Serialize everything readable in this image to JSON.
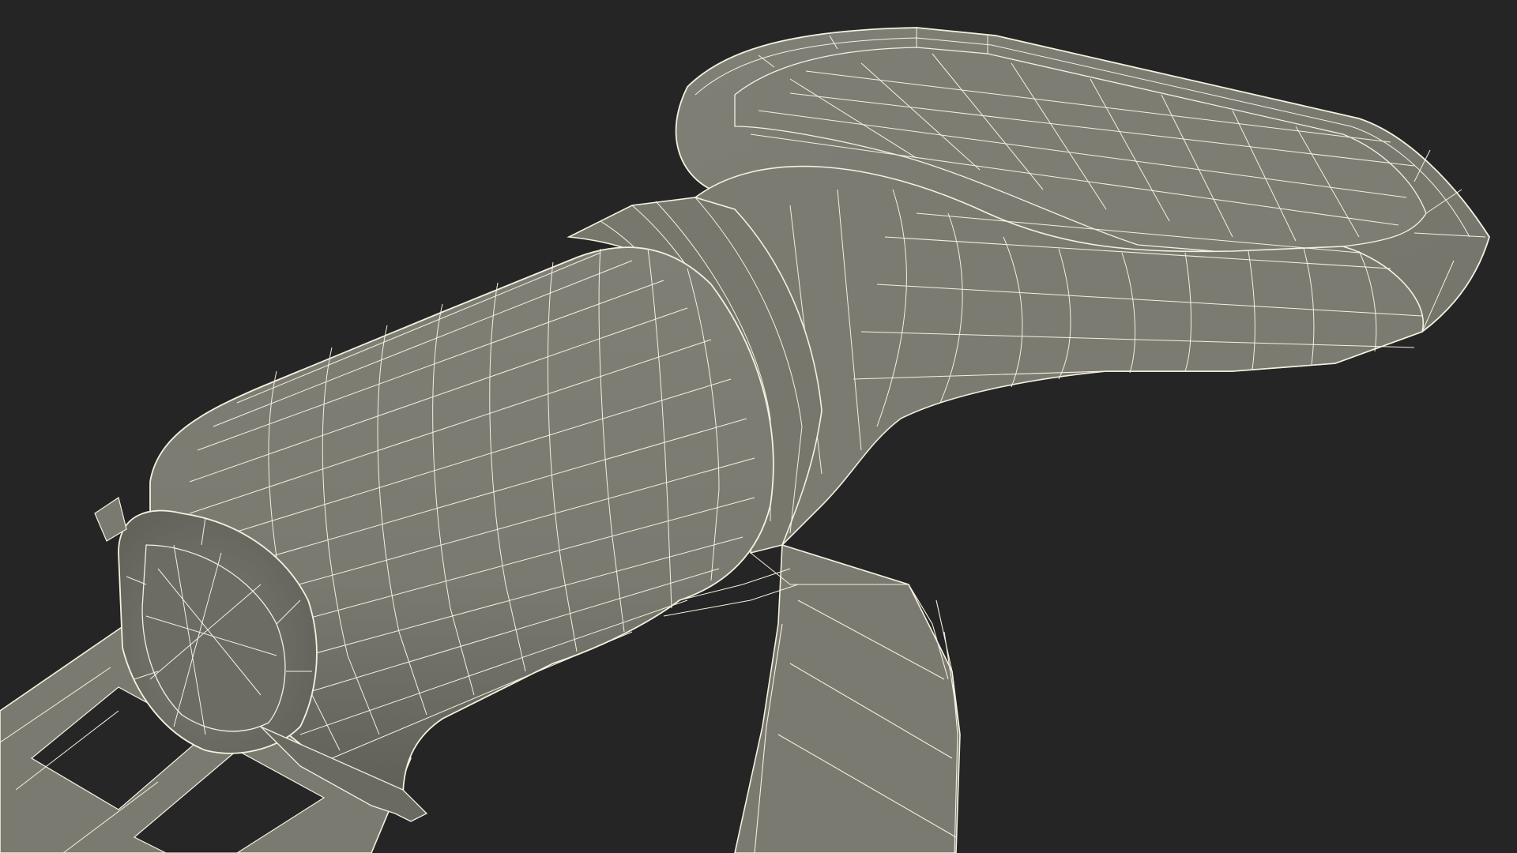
{
  "scene": {
    "background_color": "#252525",
    "surface_color": "#7b7b72",
    "surface_dark_color": "#66665e",
    "surface_shadow_color": "#55554f",
    "wire_color": "#f4f1df",
    "subject": "wireframe-3d-model"
  }
}
